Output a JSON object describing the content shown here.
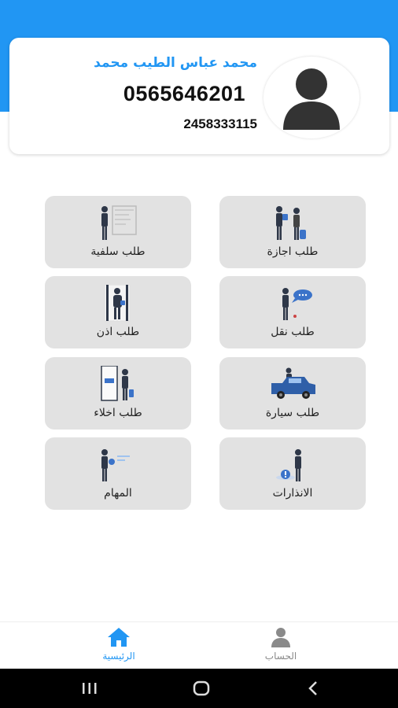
{
  "profile": {
    "name": "محمد عباس الطيب محمد",
    "phone": "0565646201",
    "id_number": "2458333115"
  },
  "tiles": [
    {
      "label": "طلب اجازة",
      "icon": "vacation-icon"
    },
    {
      "label": "طلب سلفية",
      "icon": "advance-icon"
    },
    {
      "label": "طلب نقل",
      "icon": "transfer-icon"
    },
    {
      "label": "طلب اذن",
      "icon": "permission-icon"
    },
    {
      "label": "طلب سيارة",
      "icon": "car-icon"
    },
    {
      "label": "طلب اخلاء",
      "icon": "clearance-icon"
    },
    {
      "label": "الانذارات",
      "icon": "warnings-icon"
    },
    {
      "label": "المهام",
      "icon": "tasks-icon"
    }
  ],
  "bottom_nav": {
    "home_label": "الرئيسية",
    "account_label": "الحساب"
  },
  "colors": {
    "primary": "#2196f3",
    "tile_bg": "#e2e2e2",
    "person_dark": "#2e3748",
    "accent_blue": "#3b73c9"
  }
}
